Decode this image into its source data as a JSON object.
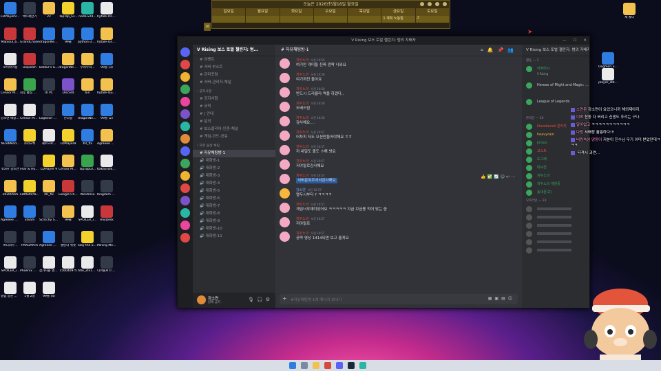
{
  "calendar": {
    "title": "오늘은 2026년5월18일 월요일",
    "days": [
      "일요일",
      "월요일",
      "화요일",
      "수요일",
      "목요일",
      "금요일",
      "토요일"
    ],
    "week": [
      "",
      "",
      "",
      "",
      "",
      "1 계획 노동절",
      "2"
    ],
    "side_num": "16"
  },
  "desktop": [
    {
      "label": "LDPlayer9_...",
      "color": "g-blue"
    },
    {
      "label": "엑트제한기",
      "color": "g-dark"
    },
    {
      "label": "22",
      "color": "g-folder"
    },
    {
      "label": "TapTap_Gl...",
      "color": "g-yellow"
    },
    {
      "label": "node-v24...",
      "color": "g-teal"
    },
    {
      "label": "hytale-lcne...",
      "color": "g-white"
    },
    {
      "label": "MajSoul_6...",
      "color": "g-red"
    },
    {
      "label": "GrandChase",
      "color": "g-red"
    },
    {
      "label": "dragonNest...",
      "color": "g-blue"
    },
    {
      "label": "99술",
      "color": "g-blue"
    },
    {
      "label": "python-3.1...",
      "color": "g-blue"
    },
    {
      "label": "hytale-lcne...",
      "color": "g-folder"
    },
    {
      "label": "보이마이정",
      "color": "g-white"
    },
    {
      "label": "Dispatch",
      "color": "g-red"
    },
    {
      "label": "Baldur's Gate 3",
      "color": "g-dark"
    },
    {
      "label": "dragonNest...",
      "color": "g-folder"
    },
    {
      "label": "우리우리...",
      "color": "g-folder"
    },
    {
      "label": "99술 (3)",
      "color": "g-blue"
    },
    {
      "label": "Censor Mod ADanMaric...",
      "color": "g-folder"
    },
    {
      "label": "최후 통일 게임 패치",
      "color": "g-green"
    },
    {
      "label": "UI PC",
      "color": "g-dark"
    },
    {
      "label": "Discord",
      "color": "g-purple"
    },
    {
      "label": "bin",
      "color": "g-folder"
    },
    {
      "label": "hytale-laun...",
      "color": "g-folder"
    },
    {
      "label": "강소연 애칭정정...",
      "color": "g-white"
    },
    {
      "label": "Censor Mod ADanMaric...",
      "color": "g-white"
    },
    {
      "label": "Logitech G HUB",
      "color": "g-dark"
    },
    {
      "label": "한다일",
      "color": "g-blue"
    },
    {
      "label": "dragonNest...",
      "color": "g-blue"
    },
    {
      "label": "99술 (2)",
      "color": "g-blue"
    },
    {
      "label": "Nice6Mod...",
      "color": "g-blue"
    },
    {
      "label": "카카오톡",
      "color": "g-yellow"
    },
    {
      "label": "해조으로...",
      "color": "g-white"
    },
    {
      "label": "LDPlayer9",
      "color": "g-yellow"
    },
    {
      "label": "XR_fix",
      "color": "g-blue"
    },
    {
      "label": "Agreeee 한글패치 (1)",
      "color": "g-folder"
    },
    {
      "label": "6597 강소연",
      "color": "g-dark"
    },
    {
      "label": "Fear & Hunger",
      "color": "g-dark"
    },
    {
      "label": "LDPlayer 9",
      "color": "g-yellow"
    },
    {
      "label": "Censor Mod ADanMaric...",
      "color": "g-folder"
    },
    {
      "label": "TapTapGl...",
      "color": "g-green"
    },
    {
      "label": "KakaoTalk 20260505",
      "color": "g-white"
    },
    {
      "label": "20260505",
      "color": "g-folder"
    },
    {
      "label": "LDMultiPla...",
      "color": "g-yellow"
    },
    {
      "label": "XR_fix",
      "color": "g-folder"
    },
    {
      "label": "Google Chrome",
      "color": "g-red"
    },
    {
      "label": "Windrose",
      "color": "g-dark"
    },
    {
      "label": "Kingdom Come De...",
      "color": "g-dark"
    },
    {
      "label": "Agreeee 한글패치",
      "color": "g-blue"
    },
    {
      "label": "Steam",
      "color": "g-blue"
    },
    {
      "label": "Scritchy Scratchy",
      "color": "g-dark"
    },
    {
      "label": "99술",
      "color": "g-folder"
    },
    {
      "label": "SPOILER_i...",
      "color": "g-white"
    },
    {
      "label": "AnyDesk",
      "color": "g-red"
    },
    {
      "label": "버디의부...",
      "color": "g-dark"
    },
    {
      "label": "PRAGMATA",
      "color": "g-dark"
    },
    {
      "label": "Agreeee 한글패치 (1)",
      "color": "g-blue"
    },
    {
      "label": "캘린더 위젯",
      "color": "g-dark"
    },
    {
      "label": "Slay the Spire 2",
      "color": "g-yellow"
    },
    {
      "label": "Mining Merchant",
      "color": "g-dark"
    },
    {
      "label": "SPOILER_i...",
      "color": "g-white"
    },
    {
      "label": "Phoenix Wright A...",
      "color": "g-dark"
    },
    {
      "label": "참가자들 명예의 전...",
      "color": "g-white"
    },
    {
      "label": "1560409?5",
      "color": "g-white"
    },
    {
      "label": "title_2fe1db...",
      "color": "g-white"
    },
    {
      "label": "디아블로 II 레저렉션",
      "color": "g-dark"
    },
    {
      "label": "열림 응진 열닫화 311",
      "color": "g-white"
    },
    {
      "label": "1월 2일",
      "color": "g-white"
    },
    {
      "label": "99술 (4)",
      "color": "g-white"
    }
  ],
  "right_desktop": [
    {
      "label": "새 폴더",
      "color": "g-folder"
    },
    {
      "label": "Oogmon SuperRum...",
      "color": "g-blue"
    },
    {
      "label": "player_dld...",
      "color": "g-white"
    }
  ],
  "discord": {
    "window_title": "V Rising 보스 토벌 챌린지: 범의 지배자",
    "guild_name": "V Rising 보스 토벌 챌린지: 범...",
    "channels": [
      {
        "type": "item",
        "label": "이벤트"
      },
      {
        "type": "item",
        "label": "서버 부스트"
      },
      {
        "type": "item",
        "label": "관리포럼"
      },
      {
        "type": "item",
        "label": "서버-관리자-채널"
      },
      {
        "type": "cat",
        "label": "공지사항"
      },
      {
        "type": "item",
        "label": "공지사항"
      },
      {
        "type": "item",
        "label": "규칙"
      },
      {
        "type": "item",
        "label": "| 안내"
      },
      {
        "type": "item",
        "label": "문의"
      },
      {
        "type": "item",
        "label": "보스클리어-인증-채널"
      },
      {
        "type": "item",
        "label": "게임-코드-공유"
      },
      {
        "type": "cat",
        "label": "자유 음성 채팅"
      },
      {
        "type": "active",
        "label": "자유채팅방-1"
      },
      {
        "type": "item",
        "label": "대화방-1"
      },
      {
        "type": "item",
        "label": "대화방-2"
      },
      {
        "type": "item",
        "label": "대화방-3"
      },
      {
        "type": "item",
        "label": "대화방-4"
      },
      {
        "type": "item",
        "label": "대화방-5"
      },
      {
        "type": "item",
        "label": "대화방-6"
      },
      {
        "type": "item",
        "label": "대화방-7"
      },
      {
        "type": "item",
        "label": "대화방-8"
      },
      {
        "type": "item",
        "label": "대화방-9"
      },
      {
        "type": "item",
        "label": "대화방-10"
      },
      {
        "type": "item",
        "label": "대화방-11"
      }
    ],
    "channel_header": "자유채팅방-1",
    "messages": [
      {
        "author": "치두노의",
        "time": "오전 10:55",
        "text": "여기만 개미들 진짜 깜짝 나와요",
        "color": "",
        "sel": false
      },
      {
        "author": "치두노의",
        "time": "오전 10:56",
        "text": "여기까진 돌아요",
        "color": "",
        "sel": false
      },
      {
        "author": "치두노의",
        "time": "오전 10:56",
        "text": "반드시 드라큘라 역을 하겠다..",
        "color": "",
        "sel": false
      },
      {
        "author": "치두노의",
        "time": "오전 10:56",
        "text": "도배드림",
        "color": "",
        "sel": false
      },
      {
        "author": "치두노의",
        "time": "오전 10:56",
        "text": "감사해요....",
        "color": "",
        "sel": false
      },
      {
        "author": "치두노의",
        "time": "오전 10:57",
        "text": "어차피 저도 오션만들어야해요 ㅎㅎ",
        "color": "",
        "sel": false
      },
      {
        "author": "치두노의",
        "time": "오전 10:57",
        "text": "저 내일도 올도 ㅎ해 봐요",
        "color": "",
        "sel": false
      },
      {
        "author": "치두노의",
        "time": "오전 10:57",
        "text": "저야말로감사해요",
        "color": "",
        "sel": false
      },
      {
        "author": "치두노의",
        "time": "오전 10:57",
        "text": "서버문여주셔서감사해요",
        "color": "",
        "sel": true
      },
      {
        "author": "강소연",
        "time": "오전 10:57",
        "text": "열두시부터 ? ㅋㅋㅋㅋ",
        "color": "blue",
        "sel": false
      },
      {
        "author": "치두노의",
        "time": "오전 10:57",
        "text": "게임너무재미있어요 ㅋㅋㅋㅋㅋ 지금 브금용 적어 맞는 중",
        "color": "",
        "sel": false
      },
      {
        "author": "치두노의",
        "time": "오전 10:57",
        "text": "저야말로",
        "color": "",
        "sel": false
      },
      {
        "author": "치두노의",
        "time": "오전 10:57",
        "text": "공략 영상 1414되면 보고 올게요",
        "color": "",
        "sel": false
      }
    ],
    "composer_placeholder": "#자유채팅방-1에 메시지 보내기",
    "user": {
      "name": "강소연",
      "status": "방해 금지"
    },
    "members_header": "V Rising 보스 토벌 챌린지: 범의 지배자",
    "member_groups": [
      {
        "title": "활동 — 1",
        "members": [
          {
            "name": "이쁘티시",
            "sub": "V Rising",
            "color": "green",
            "activity": true
          },
          {
            "name": "Heroes of Might and Magic: ...",
            "sub": "",
            "color": "",
            "activity": true
          },
          {
            "name": "League of Legends",
            "sub": "",
            "color": "",
            "activity": true
          }
        ]
      },
      {
        "title": "온라인 — 20",
        "members": [
          {
            "name": "iiiexelasiaii 관리자",
            "color": "red"
          },
          {
            "name": "heavyrain",
            "color": "yellow"
          },
          {
            "name": "jinsoo",
            "color": "green"
          },
          {
            "name": "고스트",
            "color": "red"
          },
          {
            "name": "도그래",
            "color": "green"
          },
          {
            "name": "미씨잔",
            "color": "green"
          },
          {
            "name": "치두노의",
            "color": "green"
          },
          {
            "name": "치두노의 게임중",
            "color": "green"
          },
          {
            "name": "동대문(Z)",
            "color": "green"
          }
        ]
      },
      {
        "title": "오프라인 — 23",
        "members": [
          {
            "name": "",
            "color": ""
          },
          {
            "name": "",
            "color": ""
          },
          {
            "name": "",
            "color": ""
          },
          {
            "name": "",
            "color": ""
          },
          {
            "name": "",
            "color": ""
          },
          {
            "name": "",
            "color": ""
          }
        ]
      }
    ]
  },
  "overlay": [
    {
      "nick": "소연몬",
      "text": "강소연이 요었으니까 해외제야지."
    },
    {
      "nick": "이쁘",
      "text": "친동 다 버리고 신생도 푸리는 구나."
    },
    {
      "nick": "달이없고",
      "text": "ㅋㅋㅋㅋㅋㅋㅋㅋㅋㅋㅋ"
    },
    {
      "nick": "다람",
      "text": "서배장 훌륭하다!!!"
    },
    {
      "nick": "버킹속성 땅땅이",
      "text": "저분이 친수님 무기 이미 받았던데ㅋㅋㅋ"
    },
    {
      "nick": "",
      "text": "타격시 과연..."
    }
  ]
}
